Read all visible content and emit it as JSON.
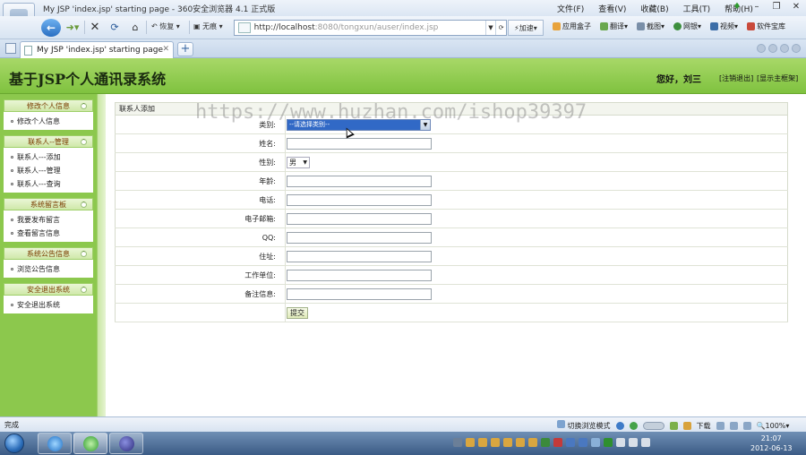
{
  "browser": {
    "window_title": "My JSP 'index.jsp' starting page - 360安全浏览器 4.1 正式版",
    "menu": [
      "文件(F)",
      "查看(V)",
      "收藏(B)",
      "工具(T)",
      "帮助(H)"
    ],
    "nav_labels": {
      "undo": "恢复",
      "no_image": "无痕"
    },
    "url_host": "http://localhost",
    "url_rest": ":8080/tongxun/auser/index.jsp",
    "accelerate_label": "加速",
    "toolbar_items": [
      "应用盒子",
      "翻译",
      "截图",
      "网银",
      "视频",
      "软件宝库"
    ],
    "tab_title": "My JSP 'index.jsp' starting page"
  },
  "page": {
    "site_title": "基于JSP个人通讯录系统",
    "greeting": "您好，刘三",
    "header_links": [
      "[注销退出]",
      "[显示主框架]"
    ],
    "nav_groups": [
      {
        "title": "修改个人信息",
        "items": [
          "修改个人信息"
        ]
      },
      {
        "title": "联系人--管理",
        "items": [
          "联系人---添加",
          "联系人---管理",
          "联系人---查询"
        ]
      },
      {
        "title": "系统留言板",
        "items": [
          "我要发布留言",
          "查看留言信息"
        ]
      },
      {
        "title": "系统公告信息",
        "items": [
          "浏览公告信息"
        ]
      },
      {
        "title": "安全退出系统",
        "items": [
          "安全退出系统"
        ]
      }
    ],
    "form": {
      "caption": "联系人添加",
      "category_label": "类别:",
      "category_value": "--请选择类别--",
      "name_label": "姓名:",
      "sex_label": "性别:",
      "sex_value": "男",
      "age_label": "年龄:",
      "phone_label": "电话:",
      "email_label": "电子邮箱:",
      "qq_label": "QQ:",
      "address_label": "住址:",
      "work_label": "工作单位:",
      "remark_label": "备注信息:",
      "submit_label": "提交"
    },
    "watermark": "https://www.huzhan.com/ishop39397"
  },
  "status": {
    "left_text": "完成",
    "switch_mode": "切换浏览模式",
    "download": "下载",
    "zoom": "100%"
  },
  "taskbar": {
    "time": "21:07",
    "date": "2012-06-13"
  }
}
